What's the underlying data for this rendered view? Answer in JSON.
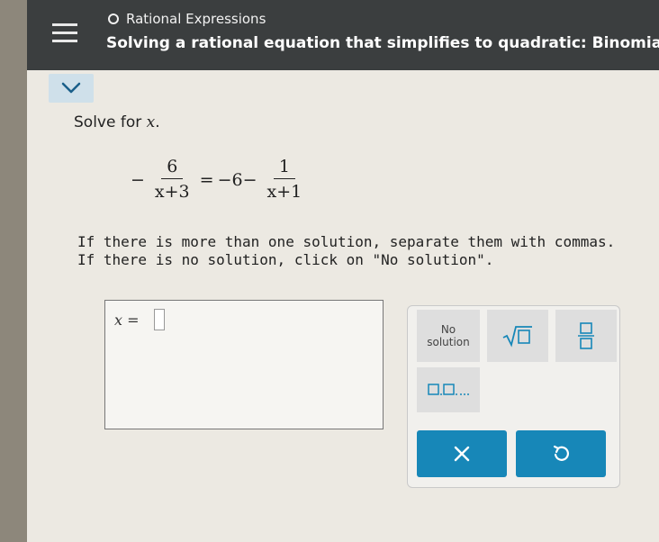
{
  "header": {
    "topic": "Rational Expressions",
    "title": "Solving a rational equation that simplifies to quadratic: Binomial..."
  },
  "problem": {
    "prompt_text": "Solve for",
    "variable": "x",
    "equation": {
      "lhs_sign": "−",
      "lhs_num": "6",
      "lhs_den": "x+3",
      "eq": "=",
      "rhs_term": "−6−",
      "rhs_num": "1",
      "rhs_den": "x+1"
    },
    "instruction_1": "If there is more than one solution, separate them with commas.",
    "instruction_2": "If there is no solution, click on \"No solution\"."
  },
  "answer": {
    "label": "x ="
  },
  "keypad": {
    "no_solution_line1": "No",
    "no_solution_line2": "solution",
    "sqrt_icon": "sqrt-icon",
    "fraction_icon": "fraction-icon",
    "list_icon": "list-icon",
    "clear_icon": "close-icon",
    "undo_icon": "undo-icon"
  },
  "colors": {
    "header_bg": "#3b3e3f",
    "accent": "#1787b8",
    "key_bg": "#dedede"
  }
}
